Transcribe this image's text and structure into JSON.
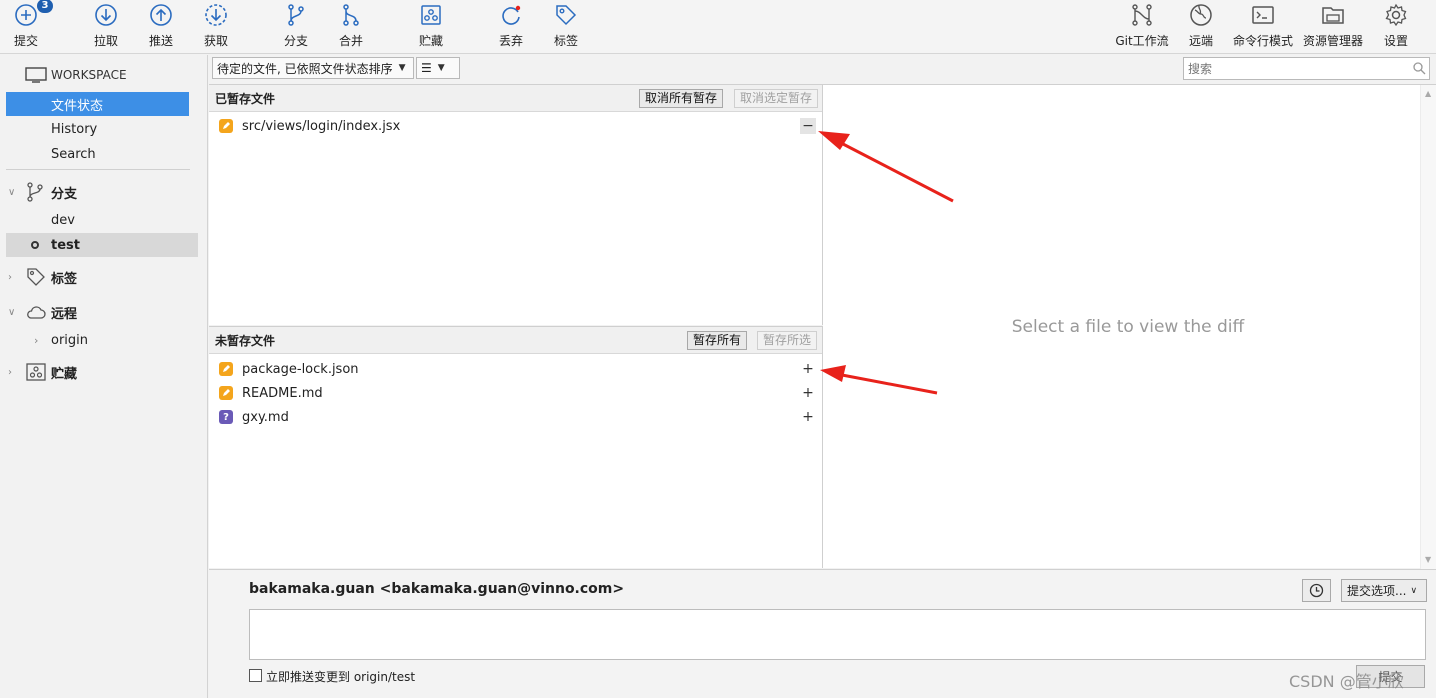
{
  "toolbar": {
    "commit": {
      "label": "提交",
      "badge": "3"
    },
    "pull": "拉取",
    "push": "推送",
    "fetch": "获取",
    "branch": "分支",
    "merge": "合并",
    "stash": "贮藏",
    "discard": "丢弃",
    "tag": "标签",
    "gitflow": "Git工作流",
    "remote": "远端",
    "terminal": "命令行模式",
    "explorer": "资源管理器",
    "settings": "设置"
  },
  "sidebar": {
    "workspace": "WORKSPACE",
    "items": [
      "文件状态",
      "History",
      "Search"
    ],
    "branches": {
      "title": "分支",
      "items": [
        "dev",
        "test"
      ]
    },
    "tags": {
      "title": "标签"
    },
    "remotes": {
      "title": "远程",
      "items": [
        "origin"
      ]
    },
    "stashes": {
      "title": "贮藏"
    }
  },
  "filter": {
    "sort_label": "待定的文件, 已依照文件状态排序",
    "view_glyph": "☰",
    "search_placeholder": "搜索"
  },
  "staged": {
    "title": "已暂存文件",
    "unstage_all": "取消所有暂存",
    "unstage_selected": "取消选定暂存",
    "files": [
      {
        "name": "src/views/login/index.jsx",
        "status": "modified"
      }
    ]
  },
  "unstaged": {
    "title": "未暂存文件",
    "stage_all": "暂存所有",
    "stage_selected": "暂存所选",
    "files": [
      {
        "name": "package-lock.json",
        "status": "modified"
      },
      {
        "name": "README.md",
        "status": "modified"
      },
      {
        "name": "gxy.md",
        "status": "untracked"
      }
    ]
  },
  "diff": {
    "placeholder": "Select a file to view the diff"
  },
  "commit": {
    "author": "bakamaka.guan <bakamaka.guan@vinno.com>",
    "options": "提交选项...",
    "push_label": "立即推送变更到 origin/test",
    "submit": "提交"
  },
  "watermark": "CSDN @管小欣",
  "colors": {
    "accent": "#3d8fe6",
    "modified": "#f4a51c",
    "untracked": "#6a5ab7",
    "annotation": "#e8221b",
    "toolbar_icon": "#2b6cc0"
  }
}
